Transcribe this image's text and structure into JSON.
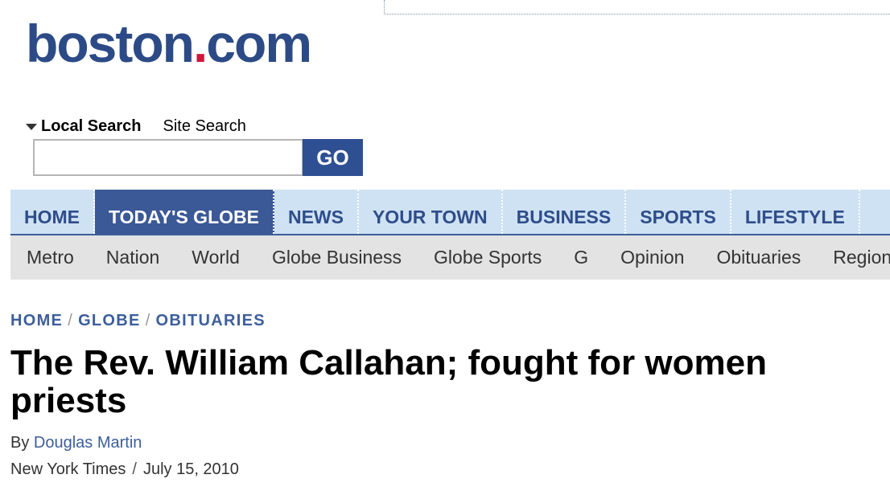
{
  "brand": {
    "logo_name": "boston",
    "logo_dot": ".",
    "logo_tld": "com",
    "primary_color": "#2c4b86",
    "dot_color": "#d0163b"
  },
  "search": {
    "tabs": [
      {
        "label": "Local Search",
        "active": true
      },
      {
        "label": "Site Search",
        "active": false
      }
    ],
    "query_value": "",
    "go_label": "GO"
  },
  "main_nav": {
    "items": [
      {
        "label": "HOME",
        "active": false
      },
      {
        "label": "TODAY'S GLOBE",
        "active": true
      },
      {
        "label": "NEWS",
        "active": false
      },
      {
        "label": "YOUR TOWN",
        "active": false
      },
      {
        "label": "BUSINESS",
        "active": false
      },
      {
        "label": "SPORTS",
        "active": false
      },
      {
        "label": "LIFESTYLE",
        "active": false
      }
    ]
  },
  "sub_nav": {
    "items": [
      "Metro",
      "Nation",
      "World",
      "Globe Business",
      "Globe Sports",
      "G",
      "Opinion",
      "Obituaries",
      "Regional"
    ]
  },
  "breadcrumb": {
    "items": [
      "HOME",
      "GLOBE",
      "OBITUARIES"
    ],
    "separator": "/"
  },
  "article": {
    "headline": "The Rev. William Callahan; fought for women priests",
    "byline_prefix": "By",
    "author": "Douglas Martin",
    "source": "New York Times",
    "date_separator": "/",
    "date": "July 15, 2010"
  }
}
